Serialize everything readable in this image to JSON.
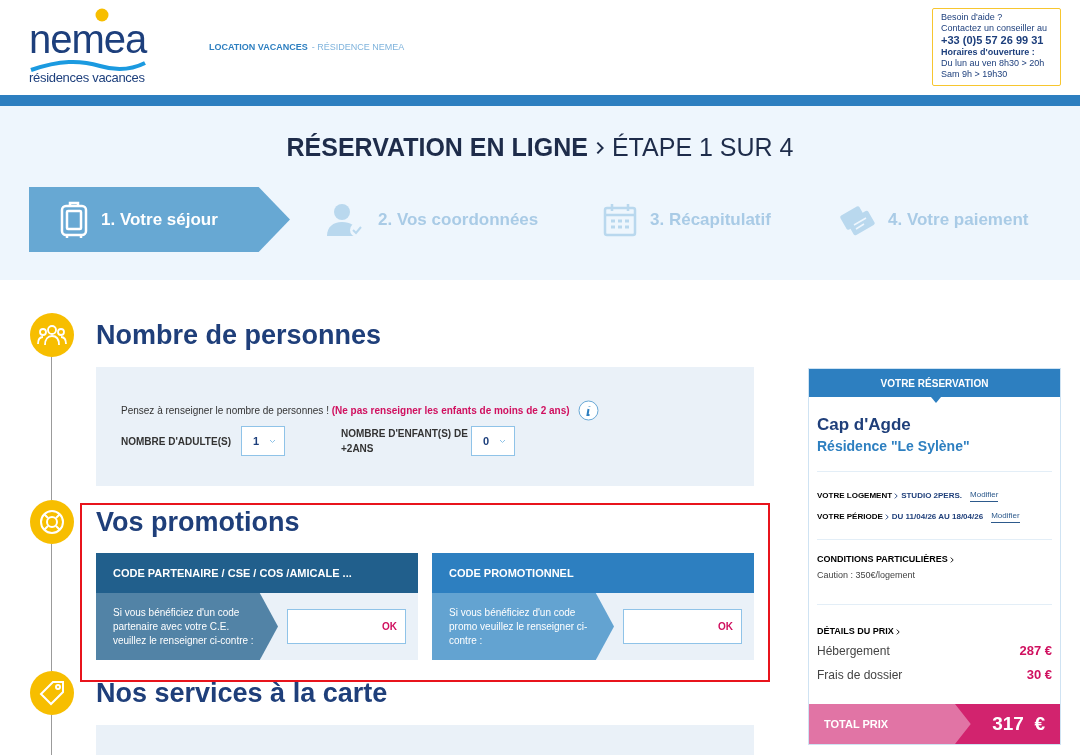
{
  "header": {
    "logo": {
      "name": "nemea",
      "tagline": "résidences vacances"
    },
    "breadcrumb": [
      {
        "text": "LOCATION VACANCES",
        "kind": "link"
      },
      {
        "text": "- RÉSIDENCE NEMEA",
        "kind": "current"
      }
    ],
    "help": [
      {
        "text": "Besoin d'aide ?",
        "kind": "plain"
      },
      {
        "text": "Contactez un conseiller au",
        "kind": "plain"
      },
      {
        "text": "+33 (0)5 57 26 99 31",
        "kind": "phone"
      },
      {
        "text": "Horaires d'ouverture :",
        "kind": "heading"
      },
      {
        "text": "Du lun au ven 8h30 > 20h",
        "kind": "plain"
      },
      {
        "text": "Sam 9h > 19h30",
        "kind": "plain"
      }
    ]
  },
  "title": {
    "main": "RÉSERVATION EN LIGNE",
    "step": "ÉTAPE 1 SUR 4"
  },
  "steps": [
    {
      "label": "1. Votre séjour",
      "selected": true
    },
    {
      "label": "2. Vos coordonnées",
      "selected": false
    },
    {
      "label": "3. Récapitulatif",
      "selected": false
    },
    {
      "label": "4. Votre paiement",
      "selected": false
    }
  ],
  "persons": {
    "title": "Nombre de personnes",
    "notice": "Pensez à renseigner le nombre de personnes ! **(Ne pas renseigner les enfants de moins de 2 ans)**",
    "fields": [
      {
        "label": "NOMBRE D'ADULTE(S)",
        "value": "1"
      },
      {
        "label": "NOMBRE D'ENFANT(S) DE +2ANS",
        "value": "0"
      }
    ]
  },
  "promotions": {
    "title": "Vos promotions",
    "highlighted": true,
    "cards": [
      {
        "title": "CODE PARTENAIRE / CSE / COS /AMICALE ...",
        "text": "Si vous bénéficiez d'un code partenaire avec votre C.E. veuillez le renseigner ci-contre :",
        "button": "OK"
      },
      {
        "title": "CODE PROMOTIONNEL",
        "text": "Si vous bénéficiez d'un code promo veuillez le renseigner ci-contre :",
        "button": "OK"
      }
    ]
  },
  "services": {
    "title": "Nos services à la carte"
  },
  "reservation": {
    "header": "VOTRE RÉSERVATION",
    "city": "Cap d'Agde",
    "residence": "Résidence \"Le Sylène\"",
    "rows": [
      {
        "label": "VOTRE LOGEMENT",
        "value": "STUDIO 2PERS.",
        "link": "Modifier"
      },
      {
        "label": "VOTRE PÉRIODE",
        "value": "DU 11/04/26 AU 18/04/26",
        "link": "Modifier"
      }
    ],
    "conditions": {
      "title": "CONDITIONS PARTICULIÈRES",
      "text": "Caution : 350€/logement"
    },
    "price": {
      "title": "DÉTAILS DU PRIX",
      "lines": [
        {
          "label": "Hébergement",
          "amount": "287 €"
        },
        {
          "label": "Frais de dossier",
          "amount": "30 €"
        }
      ]
    },
    "total": {
      "label": "TOTAL PRIX",
      "amount": "317  €"
    }
  }
}
